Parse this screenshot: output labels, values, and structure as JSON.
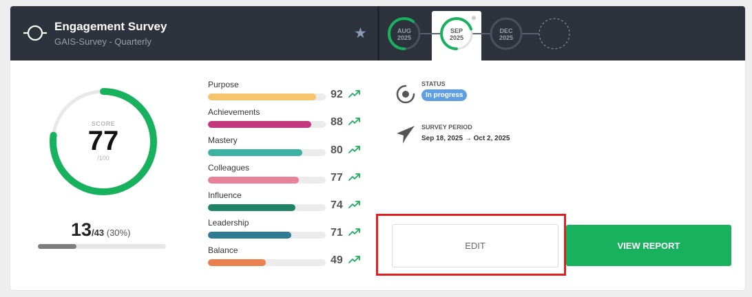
{
  "header": {
    "title": "Engagement Survey",
    "subtitle": "GAIS-Survey - Quarterly",
    "star_icon": "star-icon"
  },
  "timeline": [
    {
      "month": "AUG",
      "year": "2025",
      "progress": 0.6,
      "active": false
    },
    {
      "month": "SEP",
      "year": "2025",
      "progress": 0.7,
      "active": true
    },
    {
      "month": "DEC",
      "year": "2025",
      "progress": 0,
      "active": false
    },
    {
      "month": "",
      "year": "",
      "progress": 0,
      "active": false,
      "placeholder": true
    }
  ],
  "score": {
    "label": "SCORE",
    "value": "77",
    "max": "/100",
    "fraction": 0.77
  },
  "responses": {
    "count": "13",
    "total": "/43",
    "percent": "(30%)",
    "fraction": 0.3
  },
  "dimensions": [
    {
      "name": "Purpose",
      "value": "92",
      "fraction": 0.92,
      "color": "#f6c46a"
    },
    {
      "name": "Achievements",
      "value": "88",
      "fraction": 0.88,
      "color": "#c2387f"
    },
    {
      "name": "Mastery",
      "value": "80",
      "fraction": 0.8,
      "color": "#3eb3a3"
    },
    {
      "name": "Colleagues",
      "value": "77",
      "fraction": 0.77,
      "color": "#e8829b"
    },
    {
      "name": "Influence",
      "value": "74",
      "fraction": 0.74,
      "color": "#1e8465"
    },
    {
      "name": "Leadership",
      "value": "71",
      "fraction": 0.71,
      "color": "#2f7b93"
    },
    {
      "name": "Balance",
      "value": "49",
      "fraction": 0.49,
      "color": "#ea7f4f"
    }
  ],
  "status": {
    "title": "STATUS",
    "badge": "In progress"
  },
  "period": {
    "title": "SURVEY PERIOD",
    "value": "Sep 18, 2025 → Oct 2, 2025"
  },
  "buttons": {
    "edit": "EDIT",
    "view_report": "VIEW REPORT"
  },
  "colors": {
    "accent_green": "#18b15d",
    "header_bg": "#2d323d",
    "trend_green": "#18b15d",
    "highlight_red": "#e02020"
  }
}
